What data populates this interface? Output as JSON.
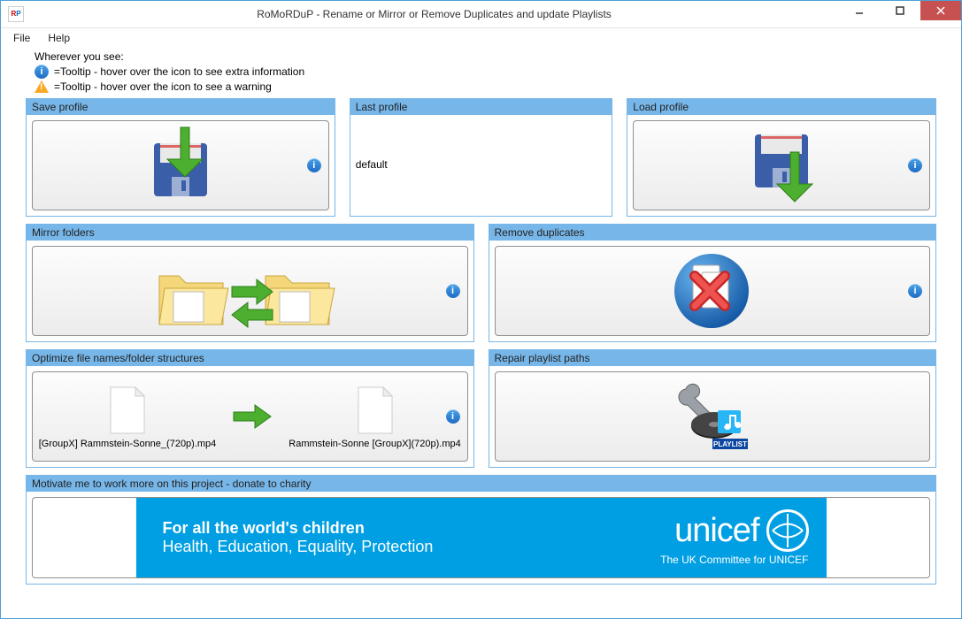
{
  "window": {
    "title": "RoMoRDuP - Rename or Mirror or Remove Duplicates and update Playlists",
    "app_icon_text_r": "R",
    "app_icon_text_p": "P"
  },
  "menu": {
    "file": "File",
    "help": "Help"
  },
  "intro": {
    "wherever": "Wherever you see:",
    "info_tooltip": "=Tooltip - hover over the icon to see extra information",
    "warn_tooltip": "=Tooltip - hover over the icon to see a warning"
  },
  "panels": {
    "save_profile": {
      "title": "Save profile"
    },
    "last_profile": {
      "title": "Last profile",
      "value": "default"
    },
    "load_profile": {
      "title": "Load profile"
    },
    "mirror_folders": {
      "title": "Mirror folders"
    },
    "remove_duplicates": {
      "title": "Remove duplicates"
    },
    "optimize": {
      "title": "Optimize file names/folder structures",
      "file_before": "[GroupX] Rammstein-Sonne_(720p).mp4",
      "file_after": "Rammstein-Sonne [GroupX](720p).mp4"
    },
    "repair_playlist": {
      "title": "Repair playlist paths",
      "badge": "PLAYLIST"
    },
    "donate": {
      "title": "Motivate me to work more on this project - donate to charity",
      "line1": "For all the world's children",
      "line2": "Health, Education, Equality, Protection",
      "brand": "unicef",
      "sub": "The UK Committee for UNICEF"
    }
  }
}
